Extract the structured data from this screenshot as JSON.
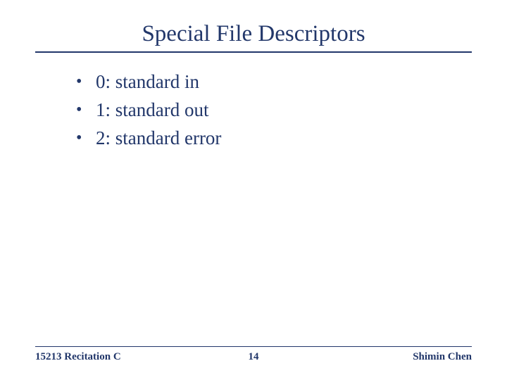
{
  "title": "Special File Descriptors",
  "bullets": [
    "0: standard in",
    "1: standard out",
    "2: standard error"
  ],
  "footer": {
    "left": "15213 Recitation C",
    "center": "14",
    "right": "Shimin Chen"
  }
}
